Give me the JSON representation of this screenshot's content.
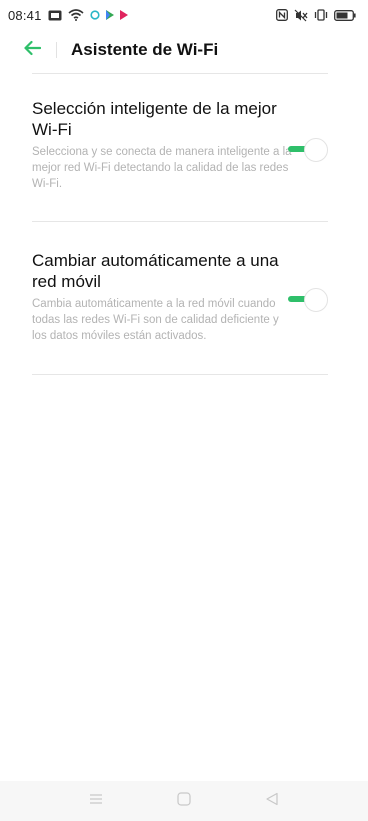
{
  "status_bar": {
    "time": "08:41",
    "icons_left": [
      "gallery-icon",
      "wifi-icon",
      "circle-icon",
      "play-store-icon",
      "media-icon"
    ],
    "icons_right": [
      "nfc-icon",
      "mute-icon",
      "vibrate-icon",
      "battery-icon"
    ]
  },
  "header": {
    "title": "Asistente de Wi-Fi",
    "back_icon": "back-arrow-icon"
  },
  "settings": [
    {
      "title": "Selección inteligente de la mejor Wi-Fi",
      "description": "Selecciona y se conecta de manera inteligente a la mejor red Wi-Fi detectando la calidad de las redes Wi-Fi.",
      "enabled": true
    },
    {
      "title": "Cambiar automáticamente a una red móvil",
      "description": "Cambia automáticamente a la red móvil cuando todas las redes Wi-Fi son de calidad deficiente y los datos móviles están activados.",
      "enabled": true
    }
  ],
  "nav_bar": {
    "buttons": [
      "menu-icon",
      "home-icon",
      "back-icon"
    ]
  },
  "colors": {
    "accent": "#2fbf6a",
    "text_primary": "#111111",
    "text_secondary": "#b3b3b3",
    "divider": "#e6e6e6",
    "nav_background": "#f7f7f7"
  }
}
